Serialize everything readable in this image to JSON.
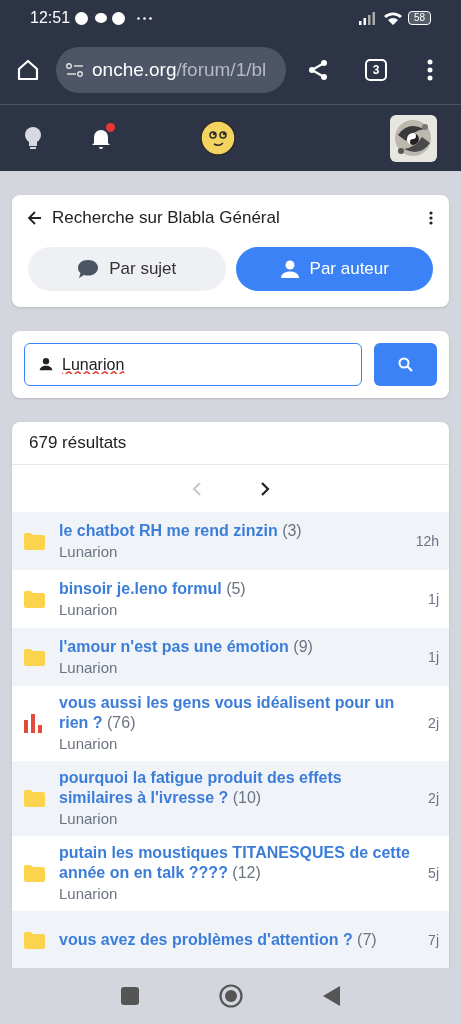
{
  "status_bar": {
    "time": "12:51",
    "battery": "58"
  },
  "browser": {
    "url_host": "onche.org",
    "url_path": "/forum/1/bl",
    "tab_count": "3"
  },
  "site_header": {
    "notification_unread": true
  },
  "search_panel": {
    "title": "Recherche sur Blabla Général",
    "modes": [
      {
        "label": "Par sujet",
        "kind": "subject",
        "selected": false
      },
      {
        "label": "Par auteur",
        "kind": "author",
        "selected": true
      }
    ],
    "query": "Lunarion"
  },
  "results": {
    "count_label": "679 résultats",
    "pagination": {
      "prev_disabled": true,
      "next_disabled": false
    },
    "rows": [
      {
        "kind": "folder",
        "title": "le chatbot RH me rend zinzin",
        "count": "(3)",
        "author": "Lunarion",
        "age": "12h"
      },
      {
        "kind": "folder",
        "title": "binsoir je.leno formul",
        "count": "(5)",
        "author": "Lunarion",
        "age": "1j"
      },
      {
        "kind": "folder",
        "title": "l'amour n'est pas une émotion",
        "count": "(9)",
        "author": "Lunarion",
        "age": "1j"
      },
      {
        "kind": "poll",
        "title": "vous aussi les gens vous idéalisent pour un rien ?",
        "count": "(76)",
        "author": "Lunarion",
        "age": "2j"
      },
      {
        "kind": "folder",
        "title": "pourquoi la fatigue produit des effets similaires à l'ivresse ?",
        "count": "(10)",
        "author": "Lunarion",
        "age": "2j"
      },
      {
        "kind": "folder",
        "title": "putain les moustiques TITANESQUES de cette année on en talk ????",
        "count": "(12)",
        "author": "Lunarion",
        "age": "5j"
      },
      {
        "kind": "folder",
        "title": "vous avez des problèmes d'attention ?",
        "count": "(7)",
        "age": "7j"
      }
    ]
  }
}
